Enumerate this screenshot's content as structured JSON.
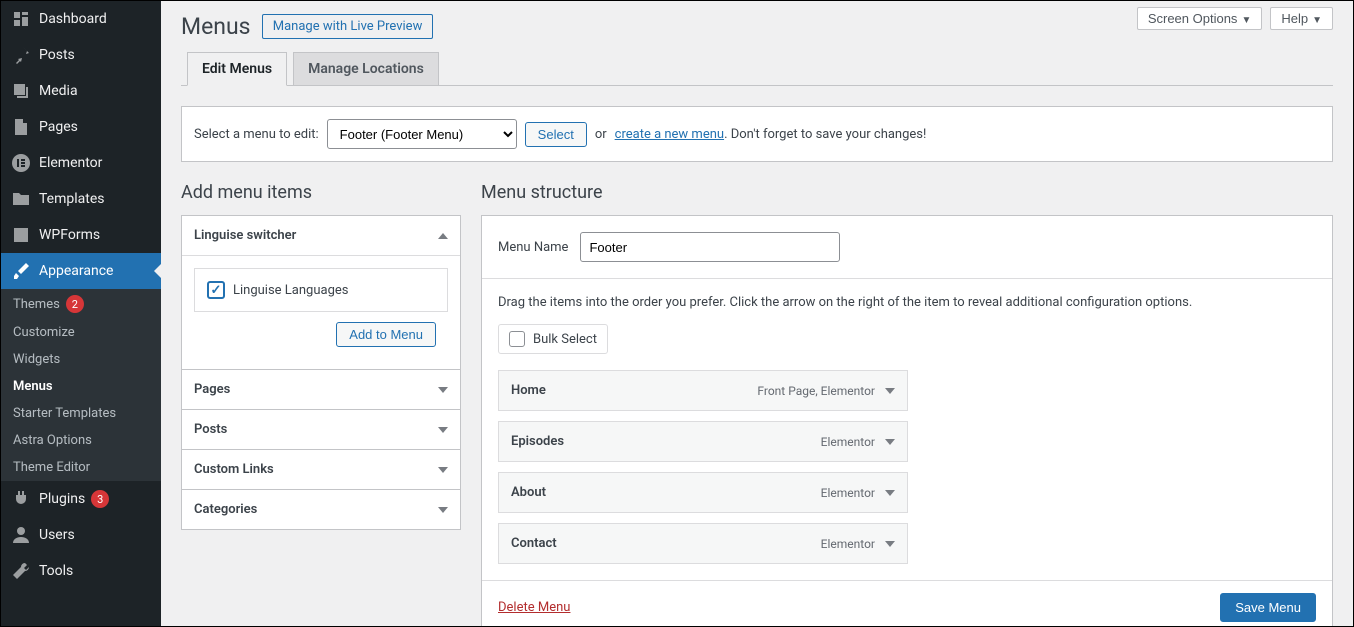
{
  "top_buttons": {
    "screen_options": "Screen Options",
    "help": "Help"
  },
  "sidebar": {
    "items": [
      {
        "label": "Dashboard",
        "icon": "dashboard"
      },
      {
        "label": "Posts",
        "icon": "pin"
      },
      {
        "label": "Media",
        "icon": "media"
      },
      {
        "label": "Pages",
        "icon": "page"
      },
      {
        "label": "Elementor",
        "icon": "elementor"
      },
      {
        "label": "Templates",
        "icon": "folder"
      },
      {
        "label": "WPForms",
        "icon": "form"
      },
      {
        "label": "Appearance",
        "icon": "brush",
        "active": true
      }
    ],
    "appearance_sub": [
      {
        "label": "Themes",
        "badge": "2"
      },
      {
        "label": "Customize"
      },
      {
        "label": "Widgets"
      },
      {
        "label": "Menus",
        "current": true
      },
      {
        "label": "Starter Templates"
      },
      {
        "label": "Astra Options"
      },
      {
        "label": "Theme Editor"
      }
    ],
    "footer_items": [
      {
        "label": "Plugins",
        "icon": "plug",
        "badge": "3"
      },
      {
        "label": "Users",
        "icon": "user"
      },
      {
        "label": "Tools",
        "icon": "wrench"
      }
    ]
  },
  "page": {
    "title": "Menus",
    "title_action": "Manage with Live Preview"
  },
  "tabs": {
    "edit": "Edit Menus",
    "locations": "Manage Locations"
  },
  "select_bar": {
    "label": "Select a menu to edit:",
    "selected": "Footer (Footer Menu)",
    "select_btn": "Select",
    "or": "or",
    "create_link": "create a new menu",
    "reminder": ". Don't forget to save your changes!"
  },
  "left": {
    "heading": "Add menu items",
    "boxes": [
      {
        "title": "Linguise switcher",
        "open": true
      },
      {
        "title": "Pages",
        "open": false
      },
      {
        "title": "Posts",
        "open": false
      },
      {
        "title": "Custom Links",
        "open": false
      },
      {
        "title": "Categories",
        "open": false
      }
    ],
    "linguise_item": "Linguise Languages",
    "add_btn": "Add to Menu"
  },
  "right": {
    "heading": "Menu structure",
    "name_label": "Menu Name",
    "name_value": "Footer",
    "instructions": "Drag the items into the order you prefer. Click the arrow on the right of the item to reveal additional configuration options.",
    "bulk_label": "Bulk Select",
    "items": [
      {
        "title": "Home",
        "type": "Front Page, Elementor"
      },
      {
        "title": "Episodes",
        "type": "Elementor"
      },
      {
        "title": "About",
        "type": "Elementor"
      },
      {
        "title": "Contact",
        "type": "Elementor"
      }
    ],
    "delete": "Delete Menu",
    "save": "Save Menu"
  }
}
